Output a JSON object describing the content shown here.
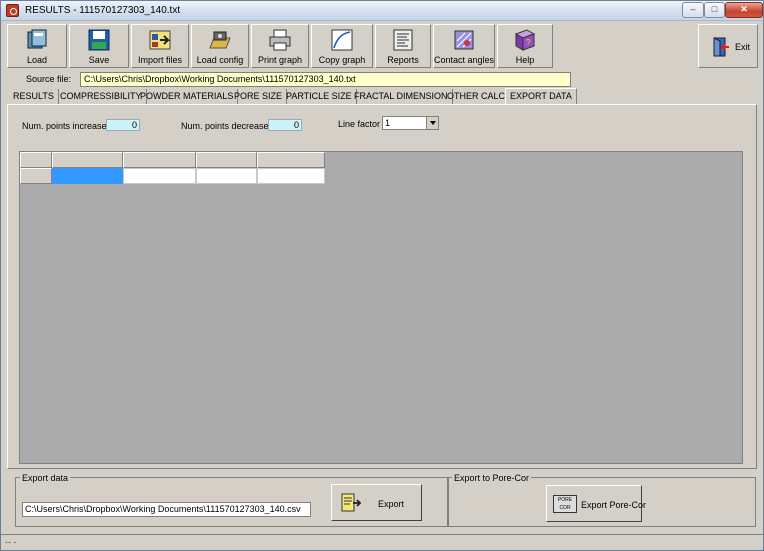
{
  "window": {
    "title": "RESULTS - 111570127303_140.txt",
    "minimize": "–",
    "maximize": "□",
    "close": "✕"
  },
  "toolbar": {
    "buttons": [
      {
        "label": "Load",
        "icon": "load-icon"
      },
      {
        "label": "Save",
        "icon": "save-icon"
      },
      {
        "label": "Import files",
        "icon": "import-icon"
      },
      {
        "label": "Load config",
        "icon": "load-config-icon"
      },
      {
        "label": "Print graph",
        "icon": "printer-icon"
      },
      {
        "label": "Copy graph",
        "icon": "copy-graph-icon"
      },
      {
        "label": "Reports",
        "icon": "reports-icon"
      },
      {
        "label": "Contact angles",
        "icon": "contact-angles-icon"
      },
      {
        "label": "Help",
        "icon": "help-book-icon"
      }
    ],
    "exit_label": "Exit"
  },
  "source": {
    "label": "Source file:",
    "value": "C:\\Users\\Chris\\Dropbox\\Working Documents\\111570127303_140.txt"
  },
  "tabs": [
    {
      "label": "RESULTS"
    },
    {
      "label": "COMPRESSIBILITY"
    },
    {
      "label": "POWDER MATERIALS"
    },
    {
      "label": "PORE SIZE"
    },
    {
      "label": "PARTICLE SIZE"
    },
    {
      "label": "FRACTAL DIMENSION"
    },
    {
      "label": "OTHER CALC."
    },
    {
      "label": "EXPORT DATA"
    }
  ],
  "controls": {
    "increase_label": "Num. points increase",
    "increase_value": "0",
    "decrease_label": "Num. points decrease",
    "decrease_value": "0",
    "line_factor_label": "Line factor",
    "line_factor_value": "1"
  },
  "export": {
    "group_title": "Export data",
    "path": "C:\\Users\\Chris\\Dropbox\\Working Documents\\111570127303_140.csv",
    "button_label": "Export",
    "porecor_group_title": "Export to Pore-Cor",
    "porecor_button_label": "Export Pore-Cor",
    "porecor_logo_top": "PORE",
    "porecor_logo_bottom": "COR"
  },
  "status": {
    "text": "-- -"
  },
  "colors": {
    "source_field_bg": "#ffffcc",
    "num_field_bg": "#ccf3f7",
    "grid_selection": "#3399ff"
  }
}
